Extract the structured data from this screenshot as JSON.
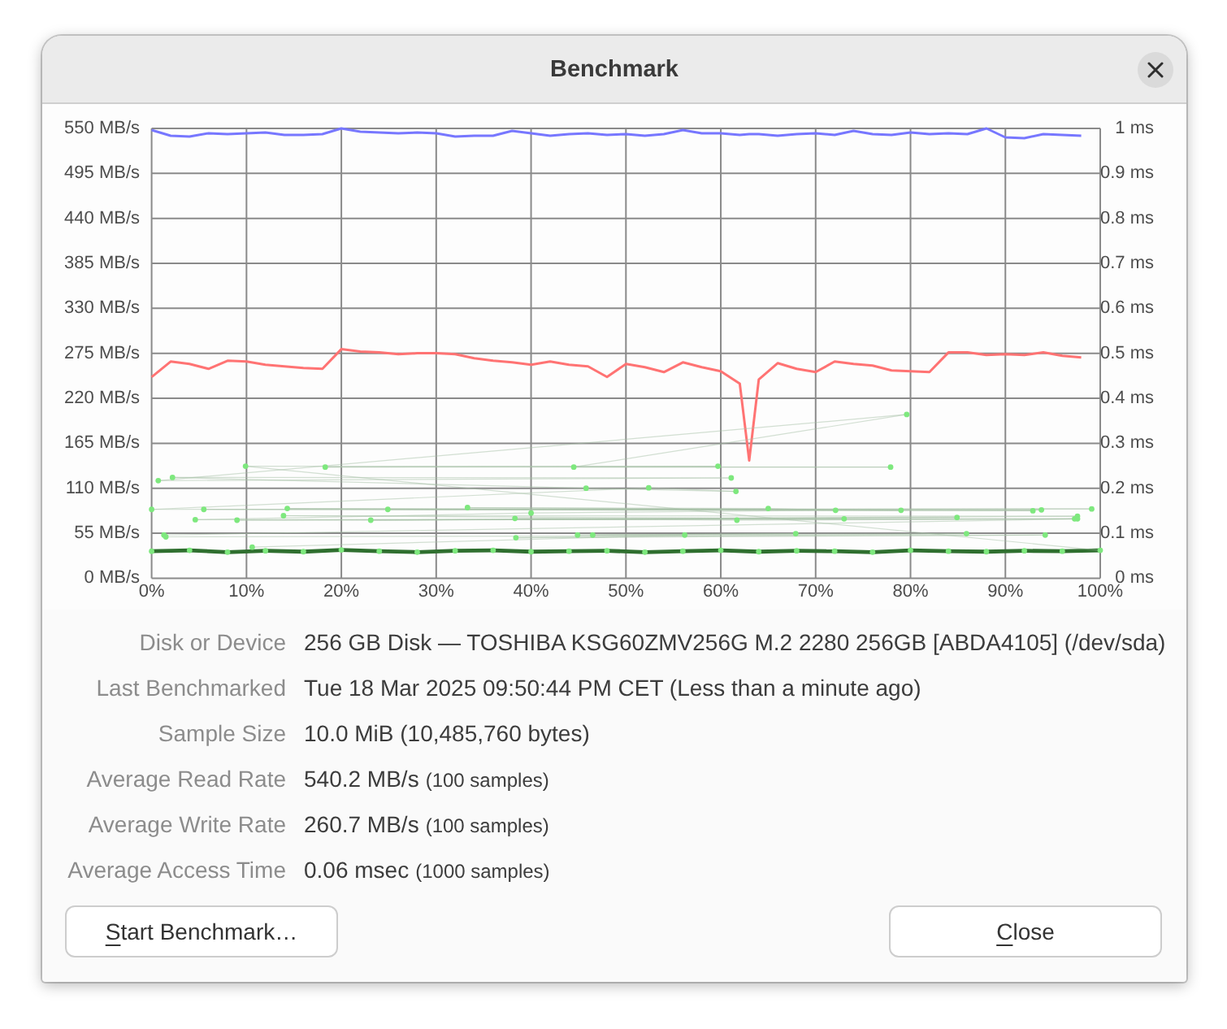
{
  "window": {
    "title": "Benchmark"
  },
  "chart": {
    "chart_data": {
      "type": "line",
      "grid": true,
      "x": [
        0,
        2,
        4,
        6,
        8,
        10,
        12,
        14,
        16,
        18,
        20,
        22,
        24,
        26,
        28,
        30,
        32,
        34,
        36,
        38,
        40,
        42,
        44,
        46,
        48,
        50,
        52,
        54,
        56,
        58,
        60,
        62,
        63,
        64,
        66,
        68,
        70,
        72,
        74,
        76,
        78,
        80,
        82,
        84,
        86,
        88,
        90,
        92,
        94,
        96,
        98
      ],
      "series": [
        {
          "color": "#7777ff",
          "values": [
            548,
            541,
            540,
            544,
            543,
            544,
            545,
            542,
            542,
            543,
            550,
            546,
            545,
            544,
            545,
            544,
            540,
            541,
            541,
            547,
            544,
            541,
            543,
            544,
            542,
            543,
            541,
            543,
            548,
            544,
            544,
            542,
            543,
            543,
            541,
            543,
            544,
            542,
            547,
            543,
            542,
            545,
            543,
            544,
            543,
            550,
            539,
            538,
            543,
            542,
            541
          ]
        },
        {
          "color": "#ff7373",
          "values": [
            246,
            265,
            262,
            256,
            266,
            265,
            261,
            259,
            257,
            256,
            280,
            277,
            276,
            274,
            275,
            275,
            274,
            269,
            266,
            264,
            261,
            265,
            261,
            259,
            246,
            262,
            258,
            252,
            264,
            258,
            253,
            238,
            144,
            243,
            263,
            256,
            252,
            265,
            262,
            260,
            254,
            253,
            252,
            276,
            276,
            273,
            274,
            273,
            276,
            272,
            270
          ]
        }
      ],
      "xlim": [
        0,
        100
      ],
      "ylim": [
        0,
        550
      ],
      "xticks": [
        {
          "value": 0,
          "label": "0%"
        },
        {
          "value": 10,
          "label": "10%"
        },
        {
          "value": 20,
          "label": "20%"
        },
        {
          "value": 30,
          "label": "30%"
        },
        {
          "value": 40,
          "label": "40%"
        },
        {
          "value": 50,
          "label": "50%"
        },
        {
          "value": 60,
          "label": "60%"
        },
        {
          "value": 70,
          "label": "70%"
        },
        {
          "value": 80,
          "label": "80%"
        },
        {
          "value": 90,
          "label": "90%"
        },
        {
          "value": 100,
          "label": "100%"
        }
      ],
      "yticks": [
        {
          "value": 0,
          "label": "0 MB/s"
        },
        {
          "value": 55,
          "label": "55 MB/s"
        },
        {
          "value": 110,
          "label": "110 MB/s"
        },
        {
          "value": 165,
          "label": "165 MB/s"
        },
        {
          "value": 220,
          "label": "220 MB/s"
        },
        {
          "value": 275,
          "label": "275 MB/s"
        },
        {
          "value": 330,
          "label": "330 MB/s"
        },
        {
          "value": 385,
          "label": "385 MB/s"
        },
        {
          "value": 440,
          "label": "440 MB/s"
        },
        {
          "value": 495,
          "label": "495 MB/s"
        },
        {
          "value": 550,
          "label": "550 MB/s"
        }
      ]
    }
  },
  "access_time_chart": {
    "chart_data": {
      "type": "scatter",
      "x": [
        0,
        4,
        8,
        12,
        16,
        20,
        24,
        28,
        32,
        36,
        40,
        44,
        48,
        52,
        56,
        60,
        64,
        68,
        72,
        76,
        80,
        84,
        88,
        92,
        96,
        100,
        9.9,
        59.7,
        18.3,
        77.9,
        44.5,
        79.6,
        0.7,
        61.1,
        2.2,
        45.8,
        61.6,
        52.4,
        0,
        99.1,
        5.5,
        92.9,
        14.3,
        93.8,
        24.9,
        79,
        33.3,
        65,
        72.1,
        40,
        4.6,
        97.3,
        9,
        73,
        13.9,
        97.6,
        23.1,
        84.9,
        38.3,
        61.7,
        97.6,
        1.3,
        1.5,
        94.2,
        38.4,
        85.9,
        44.9,
        67.9,
        46.5,
        56.2,
        10.6
      ],
      "series": [
        {
          "color": "#7ee87e",
          "values": [
            0.06,
            0.062,
            0.058,
            0.061,
            0.059,
            0.063,
            0.06,
            0.058,
            0.061,
            0.062,
            0.059,
            0.06,
            0.061,
            0.058,
            0.06,
            0.062,
            0.059,
            0.061,
            0.06,
            0.058,
            0.062,
            0.06,
            0.059,
            0.061,
            0.06,
            0.062,
            0.249,
            0.249,
            0.247,
            0.247,
            0.247,
            0.364,
            0.217,
            0.223,
            0.224,
            0.2,
            0.193,
            0.201,
            0.153,
            0.154,
            0.153,
            0.15,
            0.155,
            0.152,
            0.153,
            0.151,
            0.157,
            0.155,
            0.151,
            0.145,
            0.13,
            0.132,
            0.129,
            0.132,
            0.139,
            0.138,
            0.129,
            0.135,
            0.133,
            0.129,
            0.132,
            0.096,
            0.092,
            0.096,
            0.09,
            0.099,
            0.096,
            0.099,
            0.096,
            0.096,
            0.069
          ]
        }
      ],
      "xlim": [
        0,
        100
      ],
      "ylim": [
        0,
        1
      ],
      "yticks": [
        {
          "value": 0,
          "label": "0 ms"
        },
        {
          "value": 0.1,
          "label": "0.1 ms"
        },
        {
          "value": 0.2,
          "label": "0.2 ms"
        },
        {
          "value": 0.3,
          "label": "0.3 ms"
        },
        {
          "value": 0.4,
          "label": "0.4 ms"
        },
        {
          "value": 0.5,
          "label": "0.5 ms"
        },
        {
          "value": 0.6,
          "label": "0.6 ms"
        },
        {
          "value": 0.7,
          "label": "0.7 ms"
        },
        {
          "value": 0.8,
          "label": "0.8 ms"
        },
        {
          "value": 0.9,
          "label": "0.9 ms"
        },
        {
          "value": 1,
          "label": "1 ms"
        }
      ]
    }
  },
  "details": [
    {
      "label": "Disk or Device",
      "value": "256 GB Disk — TOSHIBA KSG60ZMV256G M.2 2280 256GB [ABDA4105] (/dev/sda)"
    },
    {
      "label": "Last Benchmarked",
      "value": "Tue 18 Mar 2025 09:50:44 PM CET (Less than a minute ago)"
    },
    {
      "label": "Sample Size",
      "value": "10.0 MiB (10,485,760 bytes)"
    },
    {
      "label": "Average Read Rate",
      "value": "540.2 MB/s",
      "note": "(100 samples)"
    },
    {
      "label": "Average Write Rate",
      "value": "260.7 MB/s",
      "note": "(100 samples)"
    },
    {
      "label": "Average Access Time",
      "value": "0.06 msec",
      "note": "(1000 samples)"
    }
  ],
  "buttons": [
    {
      "label": "Start Benchmark…",
      "mnemonic": true
    },
    {
      "label": "Close",
      "mnemonic": true
    }
  ]
}
